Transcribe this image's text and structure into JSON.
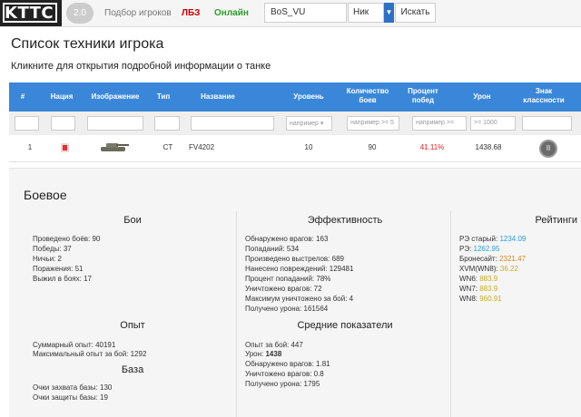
{
  "navbar": {
    "logo": "KTTC",
    "version": "2.0",
    "players_link": "Подбор игроков",
    "lbz_link": "ЛБЗ",
    "online_link": "Онлайн",
    "nick_value": "BoS_VU",
    "mode_value": "Ник",
    "search_label": "Искать"
  },
  "page": {
    "title": "Список техники игрока",
    "subtitle": "Кликните для открытия подробной информации о танке"
  },
  "table": {
    "headers": [
      "#",
      "Нация",
      "Изображение",
      "Тип",
      "Название",
      "Уровень",
      "Количество боев",
      "Процент побед",
      "Урон",
      "Знак классности"
    ],
    "filters": {
      "level_placeholder": "например",
      "battles_placeholder": "например >= 5",
      "wins_placeholder": "например >=",
      "damage_placeholder": ">= 1000"
    },
    "rows": [
      {
        "num": "1",
        "type": "CT",
        "name": "FV4202",
        "level": "10",
        "battles": "90",
        "winrate": "41.11%",
        "damage": "1438.68",
        "badge": "II"
      }
    ]
  },
  "details": {
    "title": "Боевое",
    "battles": {
      "title": "Бои",
      "items": [
        "Проведено боёв: 90",
        "Победы: 37",
        "Ничьи: 2",
        "Поражения: 51",
        "Выжил в боях: 17"
      ]
    },
    "efficiency": {
      "title": "Эффективность",
      "items": [
        "Обнаружено врагов: 163",
        "Попаданий: 534",
        "Произведено выстрелов: 689",
        "Нанесено повреждений: 129481",
        "Процент попаданий: 78%",
        "Уничтожено врагов: 72",
        "Максимум уничтожено за бой: 4",
        "Получено урона: 161564"
      ]
    },
    "ratings": {
      "title": "Рейтинги",
      "items": [
        {
          "label": "РЭ старый: ",
          "value": "1234.09"
        },
        {
          "label": "РЭ: ",
          "value": "1262.95"
        },
        {
          "label": "Бронесайт: ",
          "value": "2321.47"
        },
        {
          "label": "XVM(WN8): ",
          "value": "36.22"
        },
        {
          "label": "WN6: ",
          "value": "883.9"
        },
        {
          "label": "WN7: ",
          "value": "883.9"
        },
        {
          "label": "WN8: ",
          "value": "960.91"
        }
      ],
      "colors": [
        "#2a9fd6",
        "#2a9fd6",
        "#d48a1a",
        "#c9b020",
        "#c9b020",
        "#c9b020",
        "#c9b020"
      ]
    },
    "experience": {
      "title": "Опыт",
      "items": [
        "Суммарный опыт: 40191",
        "Максимальный опыт за бой: 1292"
      ]
    },
    "average": {
      "title": "Средние показатели",
      "items": [
        "Опыт за бой: 447",
        "Обнаружено врагов: 1.81",
        "Уничтожено врагов: 0.8",
        "Получено урона: 1795"
      ],
      "damage_label": "Урон: ",
      "damage_value": "1438"
    },
    "base": {
      "title": "База",
      "items": [
        "Очки захвата базы: 130",
        "Очки защиты базы: 19"
      ]
    }
  },
  "colors": {
    "header_blue": "#3a87d9",
    "winrate_red": "#e02020",
    "lbz_red": "#cc0000",
    "online_green": "#2a9d2a"
  }
}
